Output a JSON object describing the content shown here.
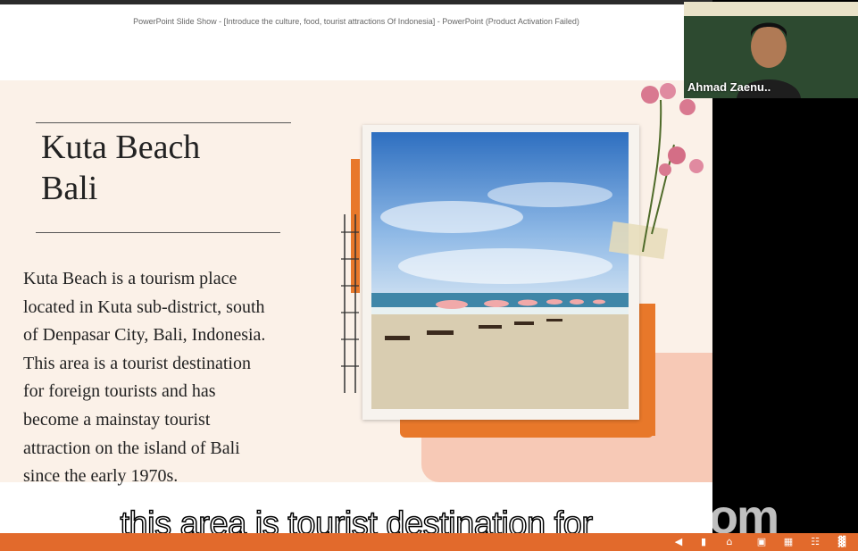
{
  "window": {
    "title": "PowerPoint Slide Show - [Introduce the culture, food, tourist attractions Of Indonesia] - PowerPoint (Product Activation Failed)"
  },
  "slide": {
    "title_line1": "Kuta Beach",
    "title_line2": "Bali",
    "body_lines": [
      "Kuta Beach is a tourism place",
      "located in Kuta sub-district, south",
      "of Denpasar City, Bali, Indonesia.",
      "This area is a tourist destination",
      "for foreign tourists and has",
      "become a mainstay tourist",
      "attraction on the island of Bali",
      "since the early 1970s."
    ]
  },
  "webcam": {
    "participant_name": "Ahmad Zaenu.."
  },
  "caption": {
    "text": "this area is tourist destination for"
  },
  "watermark": {
    "text": "zoom"
  },
  "taskbar": {
    "icons": [
      "previous-icon",
      "notes-icon",
      "home-icon",
      "slides-icon",
      "grid-icon",
      "book-icon",
      "present-icon"
    ]
  },
  "colors": {
    "accent_orange": "#e8782a",
    "slide_background": "#fbf1e8",
    "taskbar": "#e26a2c"
  }
}
